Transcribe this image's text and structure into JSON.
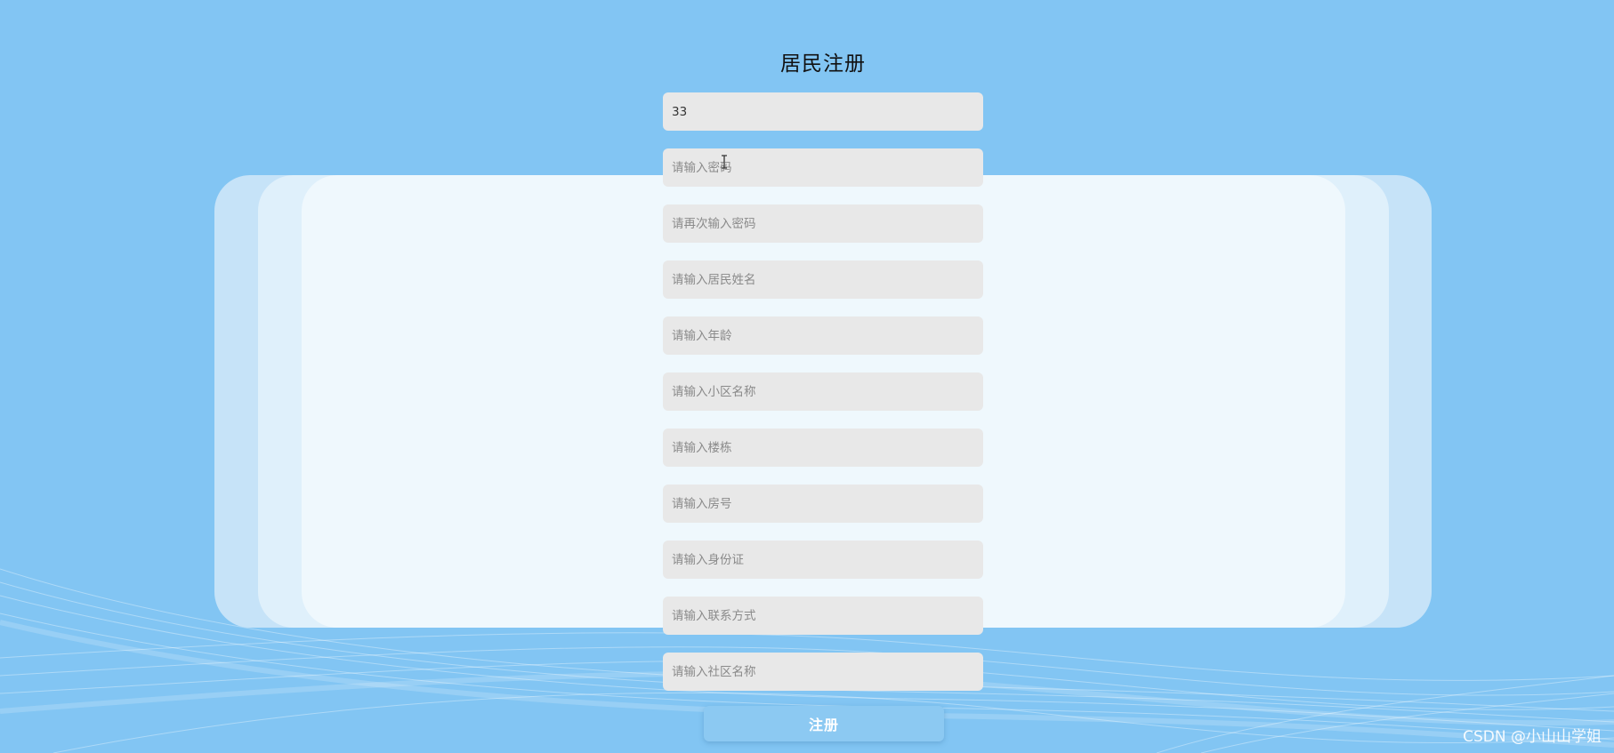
{
  "page": {
    "title": "居民注册"
  },
  "form": {
    "fields": [
      {
        "value": "33",
        "placeholder": ""
      },
      {
        "value": "",
        "placeholder": "请输入密码"
      },
      {
        "value": "",
        "placeholder": "请再次输入密码"
      },
      {
        "value": "",
        "placeholder": "请输入居民姓名"
      },
      {
        "value": "",
        "placeholder": "请输入年龄"
      },
      {
        "value": "",
        "placeholder": "请输入小区名称"
      },
      {
        "value": "",
        "placeholder": "请输入楼栋"
      },
      {
        "value": "",
        "placeholder": "请输入房号"
      },
      {
        "value": "",
        "placeholder": "请输入身份证"
      },
      {
        "value": "",
        "placeholder": "请输入联系方式"
      },
      {
        "value": "",
        "placeholder": "请输入社区名称"
      }
    ],
    "submit_label": "注册"
  },
  "watermark": "CSDN @小山山学姐",
  "colors": {
    "background": "#82c5f3",
    "card_back": "#c6e3f8",
    "card_mid": "#dff0fb",
    "card_front": "#eff8fd",
    "field_bg": "#e8e8e8",
    "button_bg": "#8cc9f2"
  },
  "icons": {
    "cursor": "text-cursor-icon"
  }
}
